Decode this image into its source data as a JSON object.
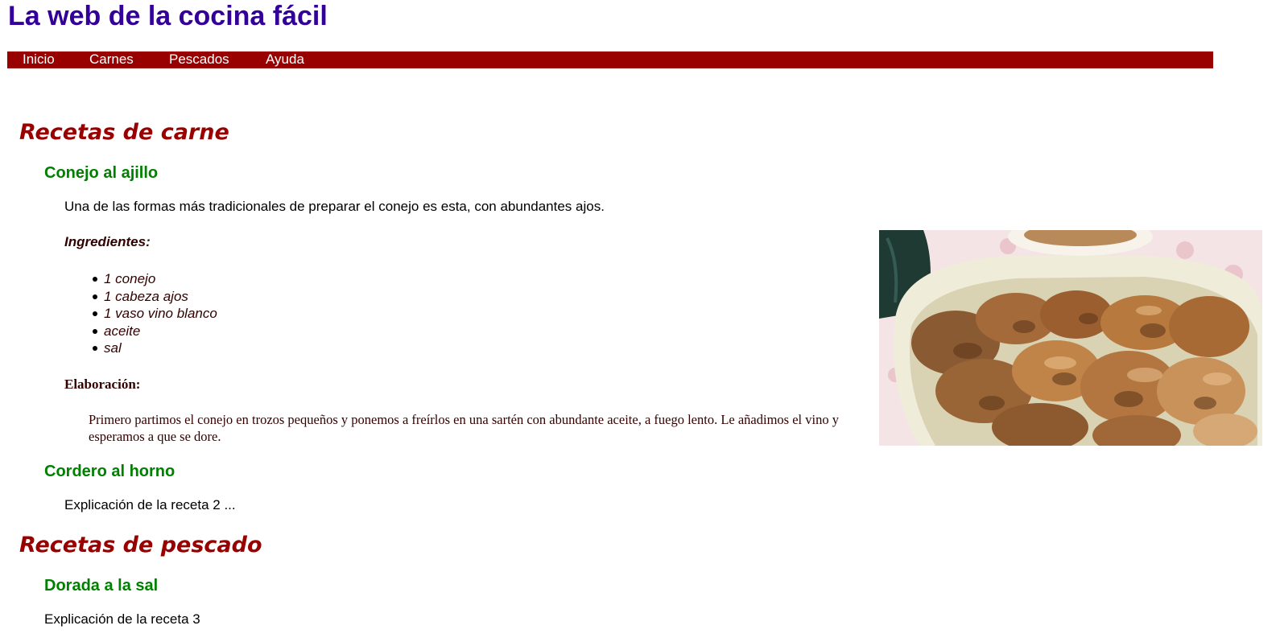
{
  "site": {
    "title": "La web de la cocina fácil"
  },
  "nav": {
    "items": [
      {
        "label": "Inicio"
      },
      {
        "label": "Carnes"
      },
      {
        "label": "Pescados"
      },
      {
        "label": "Ayuda"
      }
    ]
  },
  "sections": {
    "meat": {
      "heading": "Recetas de carne",
      "recipe1": {
        "title": "Conejo al ajillo",
        "intro": "Una de las formas más tradicionales de preparar el conejo es esta, con abundantes ajos.",
        "ingredients_label": "Ingredientes:",
        "ingredients": [
          "1 conejo",
          "1 cabeza ajos",
          "1 vaso vino blanco",
          "aceite",
          "sal"
        ],
        "elaboration_label": "Elaboración:",
        "elaboration_text": "Primero partimos el conejo en trozos pequeños y ponemos a freírlos en una sartén con abundante aceite, a fuego lento. Le añadimos el vino y esperamos a que se dore.",
        "photo_icon": "roast-rabbit-photo"
      },
      "recipe2": {
        "title": "Cordero al horno",
        "text": "Explicación de la receta 2 ..."
      }
    },
    "fish": {
      "heading": "Recetas de pescado",
      "recipe3": {
        "title": "Dorada a la sal",
        "text": "Explicación de la receta 3"
      }
    }
  },
  "colors": {
    "site_title": "#330099",
    "nav_background": "#990000",
    "section_heading": "#990000",
    "recipe_title": "#008000"
  }
}
